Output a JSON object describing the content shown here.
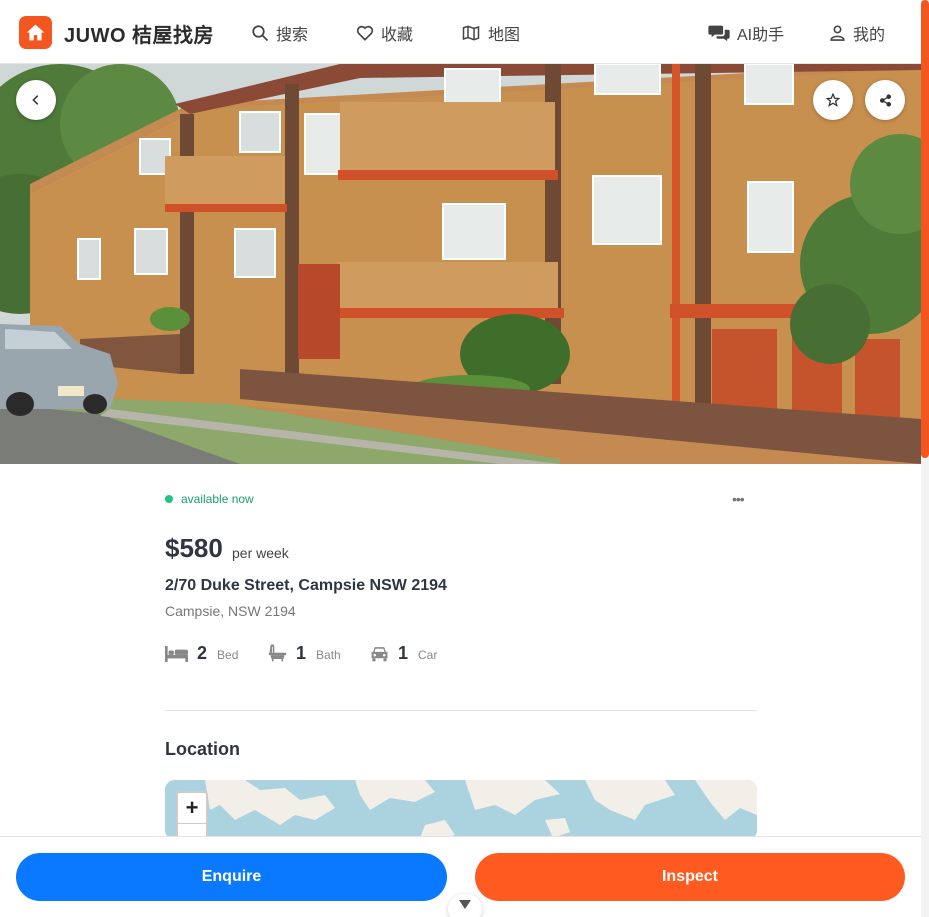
{
  "header": {
    "brand": "JUWO 桔屋找房",
    "nav": [
      {
        "label": "搜索",
        "icon": "search-icon"
      },
      {
        "label": "收藏",
        "icon": "heart-icon"
      },
      {
        "label": "地图",
        "icon": "map-icon"
      },
      {
        "label": "AI助手",
        "icon": "chat-icon"
      },
      {
        "label": "我的",
        "icon": "user-icon"
      }
    ]
  },
  "listing": {
    "status": "available now",
    "price": "$580",
    "price_period": "per week",
    "address": "2/70 Duke Street, Campsie NSW 2194",
    "suburb": "Campsie, NSW 2194",
    "features": [
      {
        "icon": "bed-icon",
        "value": "2",
        "label": "Bed"
      },
      {
        "icon": "bath-icon",
        "value": "1",
        "label": "Bath"
      },
      {
        "icon": "car-icon",
        "value": "1",
        "label": "Car"
      }
    ]
  },
  "location": {
    "title": "Location",
    "zoom_in": "+"
  },
  "actions": {
    "enquire": "Enquire",
    "inspect": "Inspect"
  },
  "colors": {
    "brand": "#f4561f",
    "enquire": "#0a78ff",
    "inspect": "#ff5a1f",
    "status": "#1ec47f"
  }
}
